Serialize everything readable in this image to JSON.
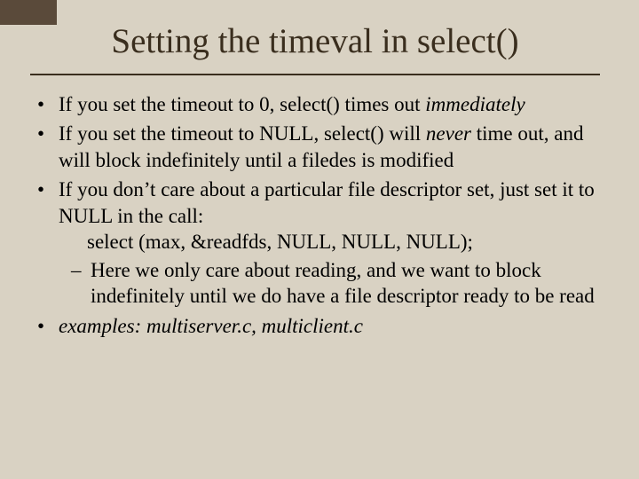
{
  "title": "Setting the timeval in select()",
  "bullets": {
    "b1_pre": "If you set the timeout to 0, select() times out ",
    "b1_em": "immediately",
    "b2_pre": "If you set the timeout to NULL, select() will ",
    "b2_em": "never",
    "b2_post": " time out, and will block indefinitely until a filedes is modified",
    "b3_text": "If you don’t care about a particular file descriptor set, just set it to NULL in the call:",
    "b3_code": "select (max, &readfds, NULL, NULL, NULL);",
    "b3_sub": "Here we only care about reading, and we want to block indefinitely until we do have a file descriptor ready to be read",
    "b4": "examples: multiserver.c, multiclient.c"
  }
}
